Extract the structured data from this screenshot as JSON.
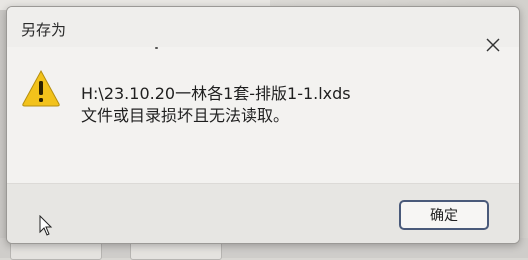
{
  "dialog": {
    "title": "另存为",
    "message_line1": "H:\\23.10.20一林各1套-排版1-1.lxds",
    "message_line2": "文件或目录损坏且无法读取。",
    "ok_label": "确定",
    "icons": {
      "warning": "warning-icon",
      "close": "close-icon"
    }
  },
  "colors": {
    "warning_fill": "#f2c21b",
    "warning_mark": "#2a2000",
    "button_border": "#4a5a7a"
  }
}
